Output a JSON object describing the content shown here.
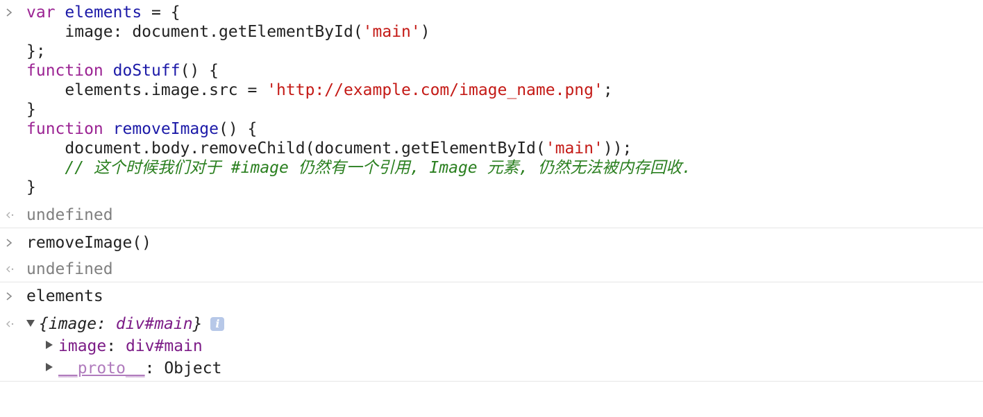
{
  "console": {
    "entry1": {
      "code_lines": {
        "l1": {
          "kw": "var",
          "id": "elements",
          "rest": " = {"
        },
        "l2": {
          "indent": "    ",
          "prop": "image",
          "mid": ": document.getElementById(",
          "str": "'main'",
          "end": ")"
        },
        "l3": "};",
        "l4": {
          "kw": "function",
          "fn": "doStuff",
          "rest": "() {"
        },
        "l5": {
          "indent": "    ",
          "pre": "elements.image.src = ",
          "str": "'http://example.com/image_name.png'",
          "end": ";"
        },
        "l6": "}",
        "l7": {
          "kw": "function",
          "fn": "removeImage",
          "rest": "() {"
        },
        "l8": {
          "indent": "    ",
          "pre": "document.body.removeChild(document.getElementById(",
          "str": "'main'",
          "end": "));"
        },
        "l9": {
          "indent": "    ",
          "comment": "// 这个时候我们对于 #image 仍然有一个引用, Image 元素, 仍然无法被内存回收."
        },
        "l10": "}"
      },
      "result": "undefined"
    },
    "entry2": {
      "input": "removeImage()",
      "result": "undefined"
    },
    "entry3": {
      "input": "elements",
      "object_summary": {
        "open": "{",
        "key": "image",
        "sep": ": ",
        "val": "div#main",
        "close": "}"
      },
      "info_icon_label": "i",
      "children": [
        {
          "key": "image",
          "sep": ": ",
          "val": "div#main"
        },
        {
          "key": "__proto__",
          "sep": ": ",
          "val": "Object"
        }
      ]
    }
  }
}
